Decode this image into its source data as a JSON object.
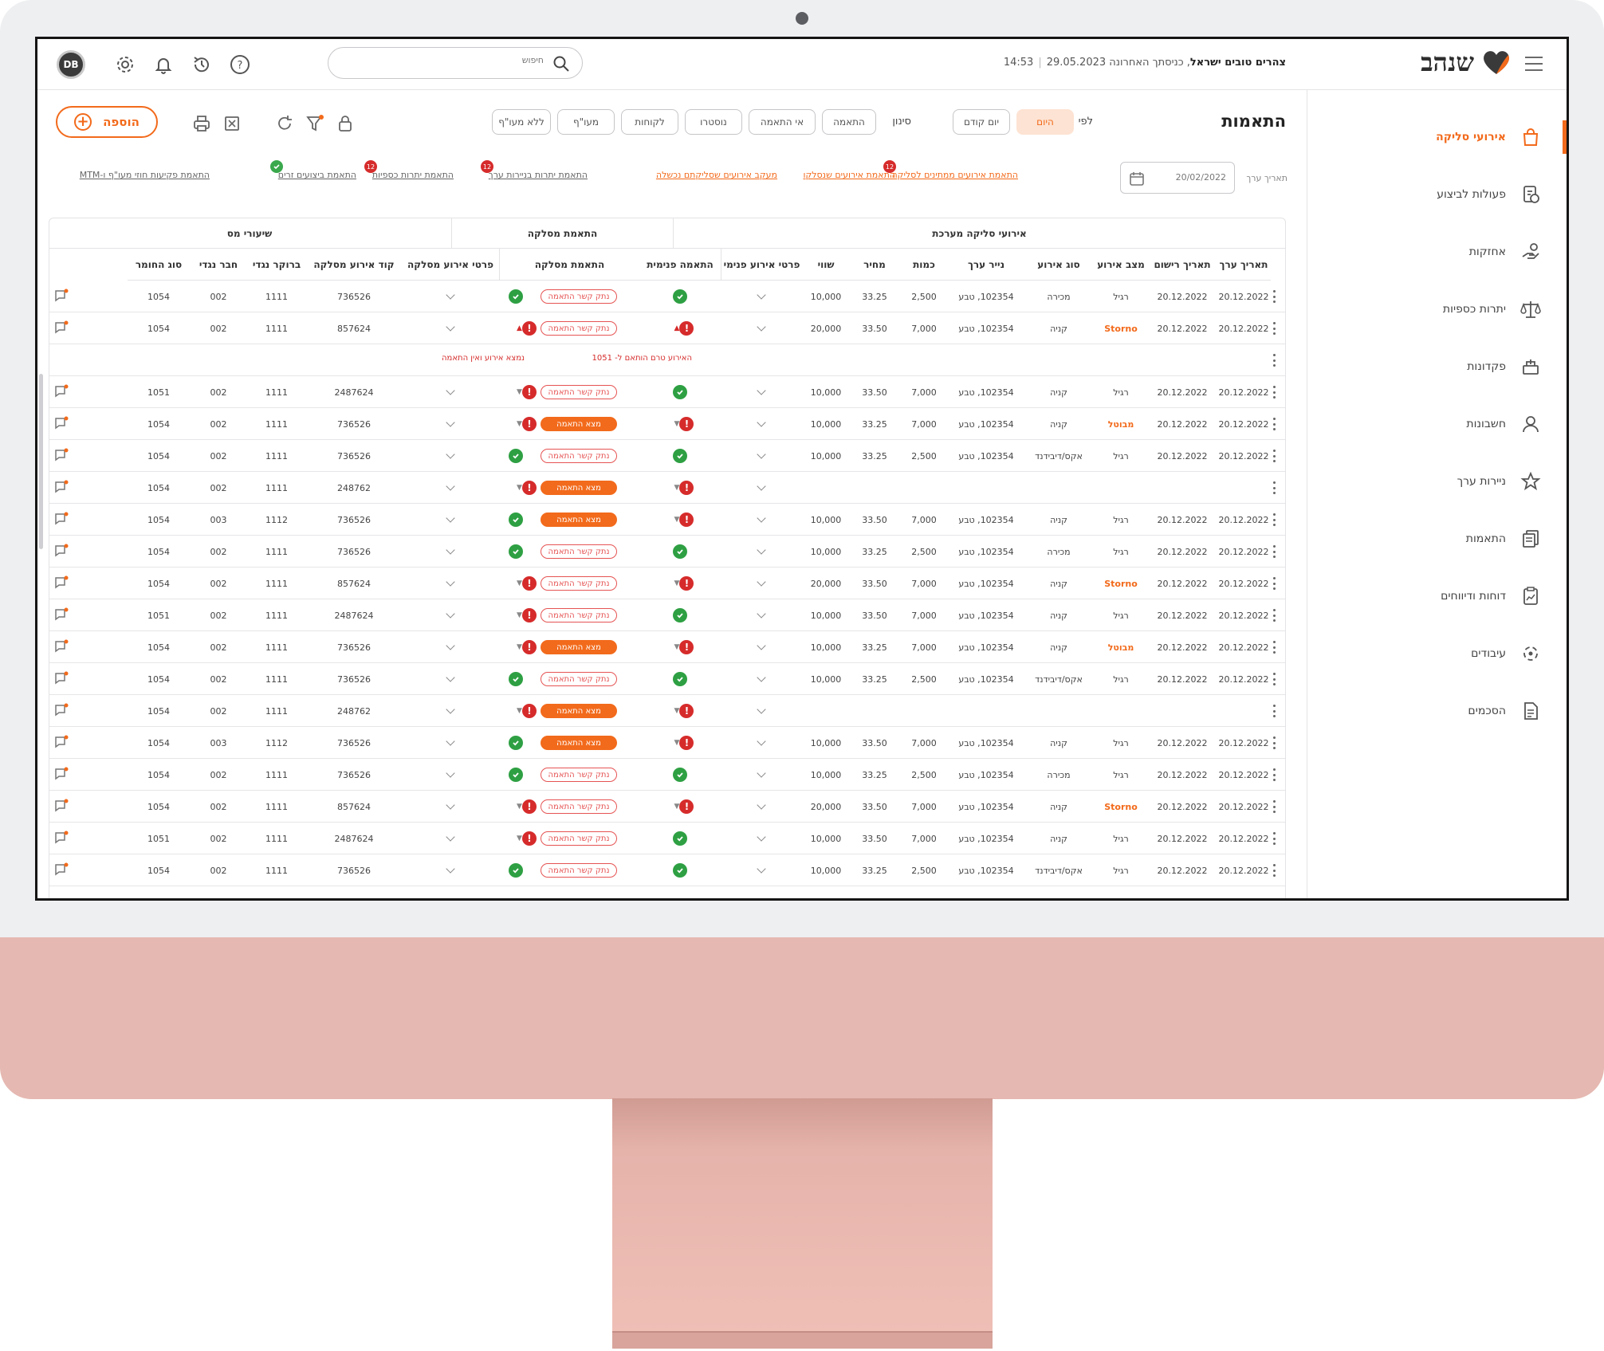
{
  "header": {
    "menu_icon": "hamburger-icon",
    "logo": "שנהב",
    "greeting_bold": "צהרים טובים ישראל",
    "greeting_rest": ", כניסתך האחרונה 29.05.2023",
    "time": "14:53",
    "search_placeholder": "חיפוש",
    "avatar": "DB",
    "icons": [
      "help-icon",
      "history-icon",
      "bell-icon",
      "gear-icon"
    ]
  },
  "sidebar": {
    "items": [
      {
        "label": "אירועי סליקה",
        "icon": "shopping-bag-icon",
        "active": true
      },
      {
        "label": "פעולות לביצוע",
        "icon": "task-icon"
      },
      {
        "label": "אחזקות",
        "icon": "hand-holding-icon"
      },
      {
        "label": "יתרות כספיות",
        "icon": "scale-icon"
      },
      {
        "label": "פקדונות",
        "icon": "deposit-icon"
      },
      {
        "label": "חשבונות",
        "icon": "user-icon"
      },
      {
        "label": "ניירות ערך",
        "icon": "star-icon"
      },
      {
        "label": "התאמות",
        "icon": "documents-icon"
      },
      {
        "label": "דוחות ודיווחים",
        "icon": "report-icon"
      },
      {
        "label": "עיבודים",
        "icon": "process-icon"
      },
      {
        "label": "הסכמים",
        "icon": "agreement-icon"
      }
    ]
  },
  "toolbar": {
    "title": "התאמות",
    "by_label": "לפי",
    "by_pills": [
      "היום",
      "יום קודם"
    ],
    "filter_label": "סינון",
    "filter_pills": [
      "התאמה",
      "אי התאמה",
      "נוסטרו",
      "לקוחות",
      "מעו\"ף",
      "ללא מעו\"ף"
    ],
    "add_label": "הוספה"
  },
  "date": {
    "label": "תאריך ערך",
    "value": "20/02/2022"
  },
  "quick_links": [
    {
      "label": "התאמת אירועים ממתינים לסליקה",
      "badge": "12",
      "style": "orange"
    },
    {
      "label": "התאמת אירועים שנסלקו",
      "badge": "",
      "style": "orange"
    },
    {
      "label": "מעקב אירועים שסליקתם נכשלה",
      "badge": "",
      "style": "orange"
    },
    {
      "label": "התאמת יתרות בניירות ערך",
      "badge": "12",
      "style": "grey"
    },
    {
      "label": "התאמת יתרות כספיות",
      "badge": "12",
      "style": "grey"
    },
    {
      "label": "התאמת ביצועים זרים",
      "badge": "ok",
      "style": "grey"
    },
    {
      "label": "התאמת פקיעות חוזי מעו\"ף ו-MTM",
      "badge": "",
      "style": "grey"
    }
  ],
  "table": {
    "groups": [
      "אירועי סליקה מערכת",
      "התאמת מסלקה",
      "שיעורי מס"
    ],
    "columns": [
      "תאריך ערך",
      "תאריך רישום",
      "מצב אירוע",
      "סוג אירוע",
      "נייר ערך",
      "כמות",
      "מחיר",
      "שווי",
      "פרטי אירוע פנימי",
      "התאמה פנימית",
      "התאמת מסלקה",
      "פרטי אירוע מסלקה",
      "קוד אירוע מסלקה",
      "ברוקר נגדי",
      "חבר נגדי",
      "סוג החומר"
    ],
    "notes": {
      "internal": "האירוע טרם הותאם ל- 1051",
      "clearing": "נמצא אירוע ואין התאמה"
    },
    "chip_labels": {
      "outline": "נתק קשר התאמה",
      "filled": "מצא התאמה"
    },
    "rows": [
      {
        "vd": "20.12.2022",
        "rd": "20.12.2022",
        "state": "רגיל",
        "type": "מכירה",
        "sec": "102354, טבע",
        "qty": "2,500",
        "price": "33.25",
        "value": "10,000",
        "int": "ok",
        "int_caret": "",
        "chip": "outline",
        "clr": "ok",
        "clr_caret": "",
        "code": "736526",
        "broker": "1111",
        "member": "002",
        "mat": "1054"
      },
      {
        "vd": "20.12.2022",
        "rd": "20.12.2022",
        "state": "Storno",
        "type": "קניה",
        "sec": "102354, טבע",
        "qty": "7,000",
        "price": "33.50",
        "value": "20,000",
        "int": "err",
        "int_caret": "▲",
        "chip": "outline",
        "clr": "err",
        "clr_caret": "▲",
        "code": "857624",
        "broker": "1111",
        "member": "002",
        "mat": "1054"
      },
      {
        "note": true
      },
      {
        "vd": "20.12.2022",
        "rd": "20.12.2022",
        "state": "רגיל",
        "type": "קניה",
        "sec": "102354, טבע",
        "qty": "7,000",
        "price": "33.50",
        "value": "10,000",
        "int": "ok",
        "int_caret": "",
        "chip": "outline",
        "clr": "err",
        "clr_caret": "▼",
        "code": "2487624",
        "broker": "1111",
        "member": "002",
        "mat": "1051"
      },
      {
        "vd": "20.12.2022",
        "rd": "20.12.2022",
        "state": "מבוטל",
        "type": "קניה",
        "sec": "102354, טבע",
        "qty": "7,000",
        "price": "33.25",
        "value": "10,000",
        "int": "err",
        "int_caret": "▼",
        "chip": "filled",
        "clr": "err",
        "clr_caret": "▼",
        "code": "736526",
        "broker": "1111",
        "member": "002",
        "mat": "1054"
      },
      {
        "vd": "20.12.2022",
        "rd": "20.12.2022",
        "state": "רגיל",
        "type": "אקס/דיבידנד",
        "sec": "102354, טבע",
        "qty": "2,500",
        "price": "33.25",
        "value": "10,000",
        "int": "ok",
        "int_caret": "",
        "chip": "outline",
        "clr": "ok",
        "clr_caret": "",
        "code": "736526",
        "broker": "1111",
        "member": "002",
        "mat": "1054"
      },
      {
        "vd": "",
        "rd": "",
        "state": "",
        "type": "",
        "sec": "",
        "qty": "",
        "price": "",
        "value": "",
        "int": "err",
        "int_caret": "▼",
        "chip": "filled",
        "clr": "err",
        "clr_caret": "▼",
        "code": "248762",
        "broker": "1111",
        "member": "002",
        "mat": "1054"
      },
      {
        "vd": "20.12.2022",
        "rd": "20.12.2022",
        "state": "רגיל",
        "type": "קניה",
        "sec": "102354, טבע",
        "qty": "7,000",
        "price": "33.50",
        "value": "10,000",
        "int": "err",
        "int_caret": "▼",
        "chip": "filled",
        "clr": "ok",
        "clr_caret": "",
        "code": "736526",
        "broker": "1112",
        "member": "003",
        "mat": "1054"
      },
      {
        "vd": "20.12.2022",
        "rd": "20.12.2022",
        "state": "רגיל",
        "type": "מכירה",
        "sec": "102354, טבע",
        "qty": "2,500",
        "price": "33.25",
        "value": "10,000",
        "int": "ok",
        "int_caret": "",
        "chip": "outline",
        "clr": "ok",
        "clr_caret": "",
        "code": "736526",
        "broker": "1111",
        "member": "002",
        "mat": "1054"
      },
      {
        "vd": "20.12.2022",
        "rd": "20.12.2022",
        "state": "Storno",
        "type": "קניה",
        "sec": "102354, טבע",
        "qty": "7,000",
        "price": "33.50",
        "value": "20,000",
        "int": "err",
        "int_caret": "▼",
        "chip": "outline",
        "clr": "err",
        "clr_caret": "▼",
        "code": "857624",
        "broker": "1111",
        "member": "002",
        "mat": "1054"
      },
      {
        "vd": "20.12.2022",
        "rd": "20.12.2022",
        "state": "רגיל",
        "type": "קניה",
        "sec": "102354, טבע",
        "qty": "7,000",
        "price": "33.50",
        "value": "10,000",
        "int": "ok",
        "int_caret": "",
        "chip": "outline",
        "clr": "err",
        "clr_caret": "▼",
        "code": "2487624",
        "broker": "1111",
        "member": "002",
        "mat": "1051"
      },
      {
        "vd": "20.12.2022",
        "rd": "20.12.2022",
        "state": "מבוטל",
        "type": "קניה",
        "sec": "102354, טבע",
        "qty": "7,000",
        "price": "33.25",
        "value": "10,000",
        "int": "err",
        "int_caret": "▼",
        "chip": "filled",
        "clr": "err",
        "clr_caret": "▼",
        "code": "736526",
        "broker": "1111",
        "member": "002",
        "mat": "1054"
      },
      {
        "vd": "20.12.2022",
        "rd": "20.12.2022",
        "state": "רגיל",
        "type": "אקס/דיבידנד",
        "sec": "102354, טבע",
        "qty": "2,500",
        "price": "33.25",
        "value": "10,000",
        "int": "ok",
        "int_caret": "",
        "chip": "outline",
        "clr": "ok",
        "clr_caret": "",
        "code": "736526",
        "broker": "1111",
        "member": "002",
        "mat": "1054"
      },
      {
        "vd": "",
        "rd": "",
        "state": "",
        "type": "",
        "sec": "",
        "qty": "",
        "price": "",
        "value": "",
        "int": "err",
        "int_caret": "▼",
        "chip": "filled",
        "clr": "err",
        "clr_caret": "▼",
        "code": "248762",
        "broker": "1111",
        "member": "002",
        "mat": "1054"
      },
      {
        "vd": "20.12.2022",
        "rd": "20.12.2022",
        "state": "רגיל",
        "type": "קניה",
        "sec": "102354, טבע",
        "qty": "7,000",
        "price": "33.50",
        "value": "10,000",
        "int": "err",
        "int_caret": "▼",
        "chip": "filled",
        "clr": "ok",
        "clr_caret": "",
        "code": "736526",
        "broker": "1112",
        "member": "003",
        "mat": "1054"
      },
      {
        "vd": "20.12.2022",
        "rd": "20.12.2022",
        "state": "רגיל",
        "type": "מכירה",
        "sec": "102354, טבע",
        "qty": "2,500",
        "price": "33.25",
        "value": "10,000",
        "int": "ok",
        "int_caret": "",
        "chip": "outline",
        "clr": "ok",
        "clr_caret": "",
        "code": "736526",
        "broker": "1111",
        "member": "002",
        "mat": "1054"
      },
      {
        "vd": "20.12.2022",
        "rd": "20.12.2022",
        "state": "Storno",
        "type": "קניה",
        "sec": "102354, טבע",
        "qty": "7,000",
        "price": "33.50",
        "value": "20,000",
        "int": "err",
        "int_caret": "▼",
        "chip": "outline",
        "clr": "err",
        "clr_caret": "▼",
        "code": "857624",
        "broker": "1111",
        "member": "002",
        "mat": "1054"
      },
      {
        "vd": "20.12.2022",
        "rd": "20.12.2022",
        "state": "רגיל",
        "type": "קניה",
        "sec": "102354, טבע",
        "qty": "7,000",
        "price": "33.50",
        "value": "10,000",
        "int": "ok",
        "int_caret": "",
        "chip": "outline",
        "clr": "err",
        "clr_caret": "▼",
        "code": "2487624",
        "broker": "1111",
        "member": "002",
        "mat": "1051"
      },
      {
        "vd": "20.12.2022",
        "rd": "20.12.2022",
        "state": "רגיל",
        "type": "אקס/דיבידנד",
        "sec": "102354, טבע",
        "qty": "2,500",
        "price": "33.25",
        "value": "10,000",
        "int": "ok",
        "int_caret": "",
        "chip": "outline",
        "clr": "ok",
        "clr_caret": "",
        "code": "736526",
        "broker": "1111",
        "member": "002",
        "mat": "1054"
      }
    ]
  },
  "colors": {
    "accent": "#f26a1b",
    "error": "#d62b2b",
    "success": "#2ea043",
    "device": "#e5b8b1"
  }
}
